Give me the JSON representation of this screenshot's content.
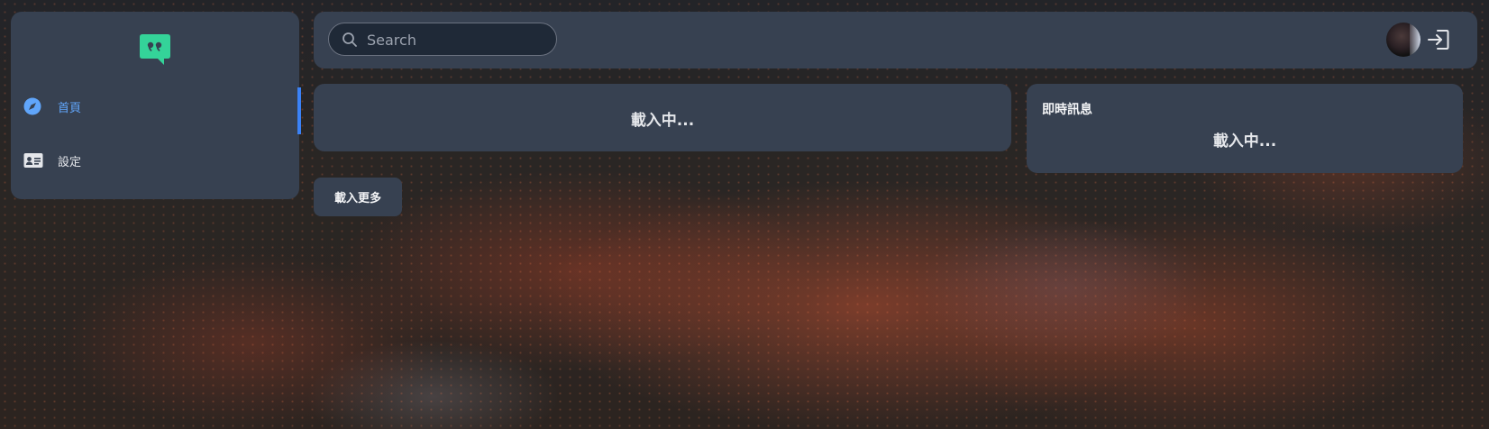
{
  "sidebar": {
    "logo_icon": "quote-chat-icon",
    "items": [
      {
        "label": "首頁",
        "icon": "compass-icon",
        "active": true
      },
      {
        "label": "設定",
        "icon": "id-card-icon",
        "active": false
      }
    ]
  },
  "header": {
    "search": {
      "placeholder": "Search",
      "value": ""
    },
    "avatar_icon": "user-avatar",
    "logout_icon": "logout-icon"
  },
  "feed": {
    "loading_text": "載入中...",
    "load_more_label": "載入更多"
  },
  "messages": {
    "title": "即時訊息",
    "loading_text": "載入中..."
  },
  "colors": {
    "panel": "#374151",
    "accent": "#3b82f6",
    "active_text": "#60a5fa",
    "logo": "#34d399"
  }
}
